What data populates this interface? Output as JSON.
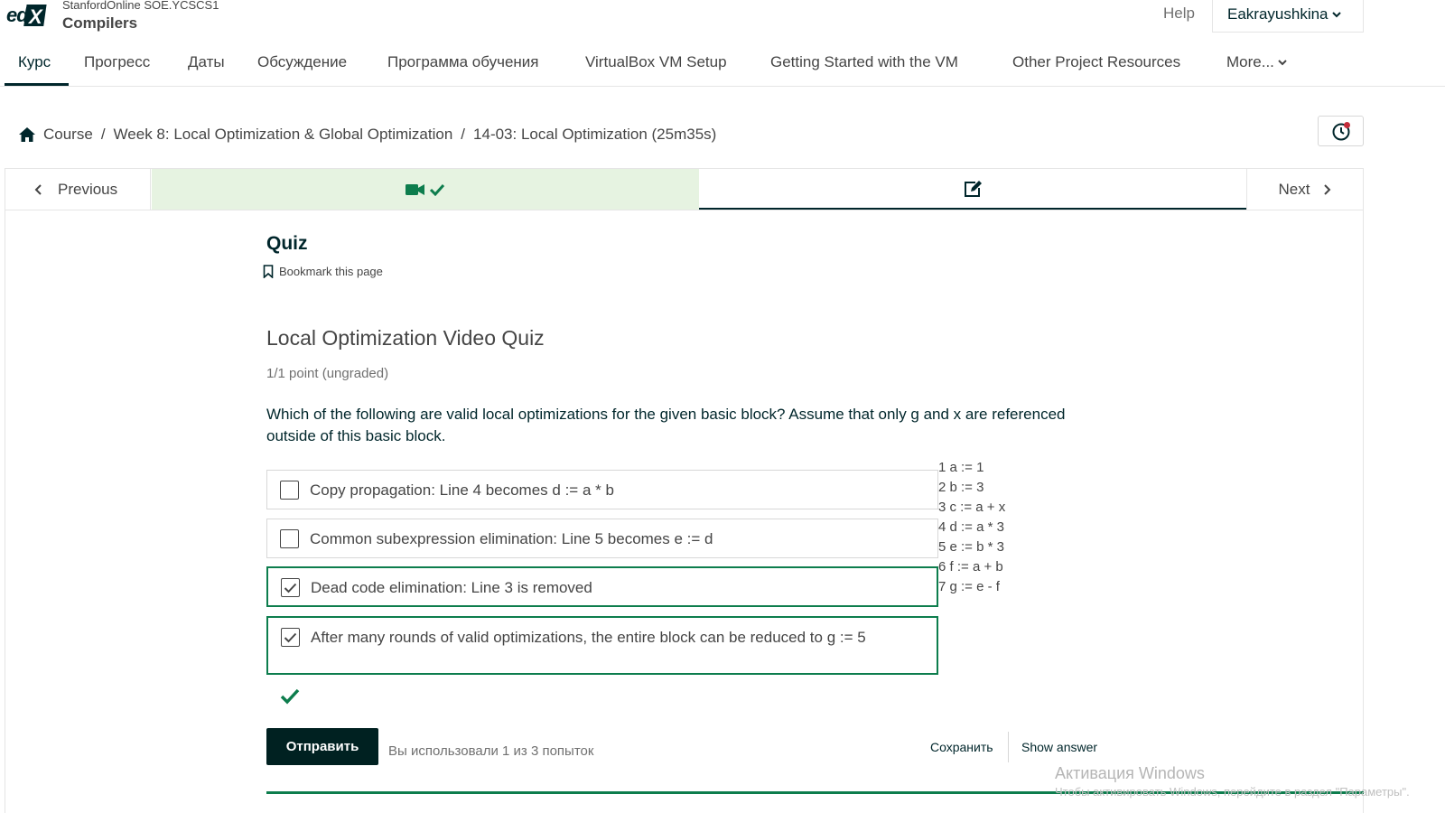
{
  "header": {
    "course_org": "StanfordOnline SOE.YCSCS1",
    "course_title": "Compilers",
    "help": "Help",
    "username": "Eakrayushkina"
  },
  "tabs": [
    {
      "label": "Курс",
      "active": true
    },
    {
      "label": "Прогресс"
    },
    {
      "label": "Даты"
    },
    {
      "label": "Обсуждение"
    },
    {
      "label": "Программа обучения"
    },
    {
      "label": "VirtualBox VM Setup"
    },
    {
      "label": "Getting Started with the VM"
    },
    {
      "label": "Other Project Resources"
    },
    {
      "label": "More..."
    }
  ],
  "breadcrumb": [
    "Course",
    "Week 8: Local Optimization & Global Optimization",
    "14-03: Local Optimization (25m35s)"
  ],
  "sequence": {
    "previous": "Previous",
    "next": "Next",
    "units": [
      {
        "icon": "video-icon",
        "complete": true,
        "active": false
      },
      {
        "icon": "edit-icon",
        "complete": false,
        "active": true
      }
    ]
  },
  "unit": {
    "title": "Quiz",
    "bookmark": "Bookmark this page"
  },
  "problem": {
    "title": "Local Optimization Video Quiz",
    "points": "1/1 point (ungraded)",
    "question": "Which of the following are valid local optimizations for the given basic block? Assume that only g and x are referenced outside of this basic block.",
    "choices": [
      {
        "label": "Copy propagation: Line 4 becomes d := a * b",
        "checked": false
      },
      {
        "label": "Common subexpression elimination: Line 5 becomes e := d",
        "checked": false
      },
      {
        "label": "Dead code elimination: Line 3 is removed",
        "checked": true
      },
      {
        "label": "After many rounds of valid optimizations, the entire block can be reduced to g := 5",
        "checked": true
      }
    ],
    "code_lines": [
      "1 a := 1",
      "2 b := 3",
      "3 c := a + x",
      "4 d := a * 3",
      "5 e := b * 3",
      "6 f := a + b",
      "7 g := e - f"
    ],
    "status": "correct",
    "submit": "Отправить",
    "attempts": "Вы использовали 1 из 3 попыток",
    "save": "Сохранить",
    "show_answer": "Show answer"
  },
  "watermark": {
    "title": "Активация Windows",
    "subtitle": "Чтобы активировать Windows, перейдите в раздел \"Параметры\"."
  },
  "colors": {
    "brand_dark": "#00262b",
    "success": "#0d7d4d",
    "completed_bg": "#e6f3e1",
    "submit_bg": "#002121"
  }
}
